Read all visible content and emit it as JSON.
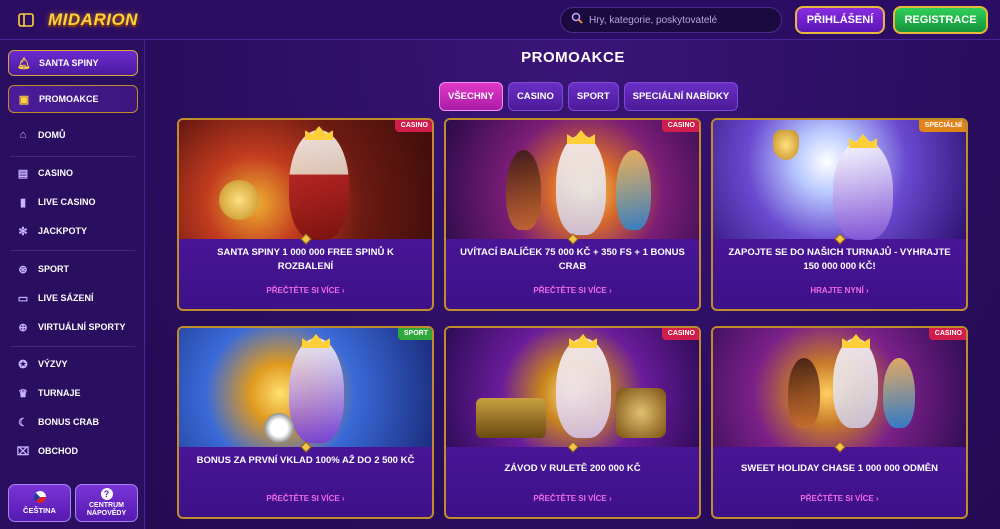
{
  "header": {
    "logo": "MIDARION",
    "search_placeholder": "Hry, kategorie, poskytovatelé",
    "login_label": "PŘIHLÁŠENÍ",
    "register_label": "REGISTRACE"
  },
  "sidebar": {
    "items": [
      {
        "label": "SANTA SPINY",
        "icon": "bell-icon"
      },
      {
        "label": "PROMOAKCE",
        "icon": "gift-icon"
      },
      {
        "label": "DOMŮ",
        "icon": "home-icon"
      },
      {
        "label": "CASINO",
        "icon": "slot-machine-icon"
      },
      {
        "label": "LIVE CASINO",
        "icon": "cards-icon"
      },
      {
        "label": "JACKPOTY",
        "icon": "jackpot-icon"
      },
      {
        "label": "SPORT",
        "icon": "ball-icon"
      },
      {
        "label": "LIVE SÁZENÍ",
        "icon": "live-icon"
      },
      {
        "label": "VIRTUÁLNÍ SPORTY",
        "icon": "gamepad-icon"
      },
      {
        "label": "VÝZVY",
        "icon": "challenge-icon"
      },
      {
        "label": "TURNAJE",
        "icon": "trophy-icon"
      },
      {
        "label": "BONUS CRAB",
        "icon": "crab-icon"
      },
      {
        "label": "OBCHOD",
        "icon": "shop-icon"
      }
    ],
    "language_label": "ČEŠTINA",
    "help_label_1": "CENTRUM",
    "help_label_2": "NÁPOVĚDY"
  },
  "main": {
    "title": "PROMOAKCE",
    "tabs": [
      {
        "label": "VŠECHNY",
        "active": true
      },
      {
        "label": "CASINO",
        "active": false
      },
      {
        "label": "SPORT",
        "active": false
      },
      {
        "label": "SPECIÁLNÍ NABÍDKY",
        "active": false
      }
    ],
    "cards": [
      {
        "badge": "CASINO",
        "title": "SANTA SPINY 1 000 000 FREE SPINŮ K ROZBALENÍ",
        "link": "PŘEČTĚTE SI VÍCE ›"
      },
      {
        "badge": "CASINO",
        "title": "UVÍTACÍ BALÍČEK 75 000 KČ + 350 FS + 1 BONUS CRAB",
        "link": "PŘEČTĚTE SI VÍCE ›"
      },
      {
        "badge": "SPECIÁLNÍ",
        "title": "ZAPOJTE SE DO NAŠICH TURNAJŮ - VYHRAJTE 150 000 000 KČ!",
        "link": "HRAJTE NYNÍ ›"
      },
      {
        "badge": "SPORT",
        "title": "BONUS ZA PRVNÍ VKLAD 100% AŽ DO 2 500 KČ",
        "link": "PŘEČTĚTE SI VÍCE ›"
      },
      {
        "badge": "CASINO",
        "title": "ZÁVOD V RULETĚ 200 000 KČ",
        "link": "PŘEČTĚTE SI VÍCE ›"
      },
      {
        "badge": "CASINO",
        "title": "SWEET HOLIDAY CHASE 1 000 000 ODMĚN",
        "link": "PŘEČTĚTE SI VÍCE ›"
      }
    ]
  },
  "colors": {
    "background": "#2a0e60",
    "accent_pink": "#e238c8",
    "login_purple": "#8a2be2",
    "register_green": "#2fd05a",
    "gold_border": "#c08c2c",
    "badge_casino": "#d11d4b",
    "badge_sport": "#2fa83c",
    "badge_special": "#e0831b"
  }
}
